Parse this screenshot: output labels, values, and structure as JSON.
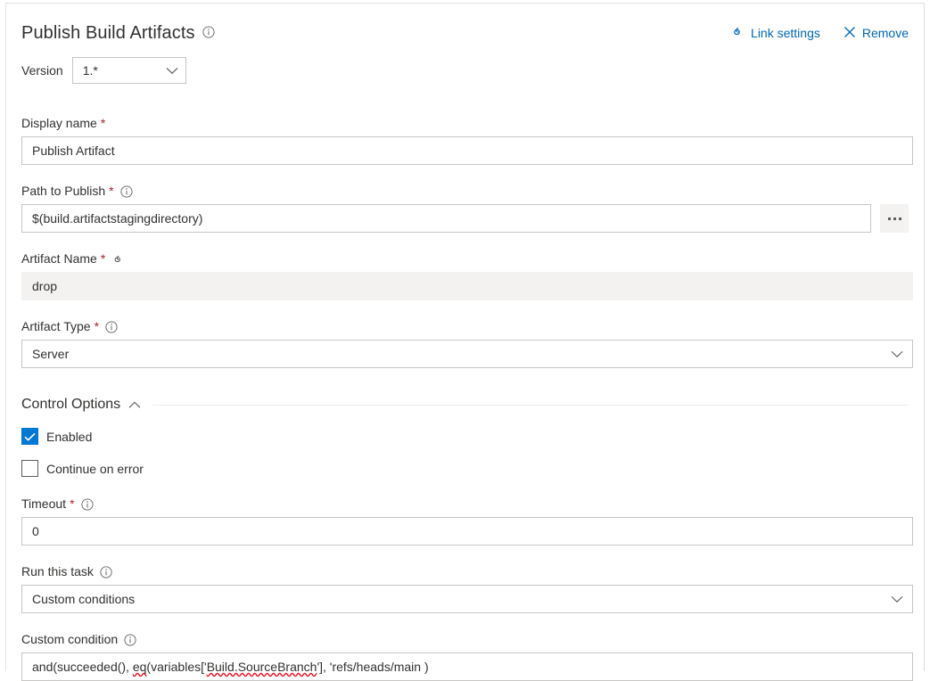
{
  "header": {
    "title": "Publish Build Artifacts",
    "info_icon": "info-icon",
    "link_settings_label": "Link settings",
    "link_settings_icon": "link-icon",
    "remove_label": "Remove",
    "remove_icon": "close-icon"
  },
  "version": {
    "label": "Version",
    "value": "1.*",
    "chevron_icon": "chevron-down-icon"
  },
  "fields": {
    "display_name": {
      "label": "Display name",
      "required": "*",
      "value": "Publish Artifact"
    },
    "path_to_publish": {
      "label": "Path to Publish",
      "required": "*",
      "info_icon": "info-icon",
      "value": "$(build.artifactstagingdirectory)",
      "browse_label": "..."
    },
    "artifact_name": {
      "label": "Artifact Name",
      "required": "*",
      "link_icon": "link-icon",
      "value": "drop"
    },
    "artifact_type": {
      "label": "Artifact Type",
      "required": "*",
      "info_icon": "info-icon",
      "value": "Server",
      "chevron_icon": "chevron-down-icon"
    }
  },
  "control_options": {
    "title": "Control Options",
    "chevron_icon": "chevron-up-icon",
    "enabled": {
      "label": "Enabled",
      "checked": true
    },
    "continue_on_error": {
      "label": "Continue on error",
      "checked": false
    },
    "timeout": {
      "label": "Timeout",
      "required": "*",
      "info_icon": "info-icon",
      "value": "0"
    },
    "run_this_task": {
      "label": "Run this task",
      "info_icon": "info-icon",
      "value": "Custom conditions",
      "chevron_icon": "chevron-down-icon"
    },
    "custom_condition": {
      "label": "Custom condition",
      "info_icon": "info-icon",
      "value": "and(succeeded(), eq(variables['Build.SourceBranch'], 'refs/heads/main )",
      "segments": [
        {
          "text": "and(succeeded(), ",
          "misspelled": false
        },
        {
          "text": "eq",
          "misspelled": true
        },
        {
          "text": "(variables['",
          "misspelled": false
        },
        {
          "text": "Build.SourceBranch",
          "misspelled": true
        },
        {
          "text": "'], 'refs/heads/main )",
          "misspelled": false
        }
      ]
    }
  },
  "colors": {
    "accent": "#0078d4",
    "link": "#0067b8",
    "required": "#a4262c",
    "border": "#c8c6c4",
    "readonly_bg": "#f3f2f1",
    "spell_error": "#e81123"
  }
}
